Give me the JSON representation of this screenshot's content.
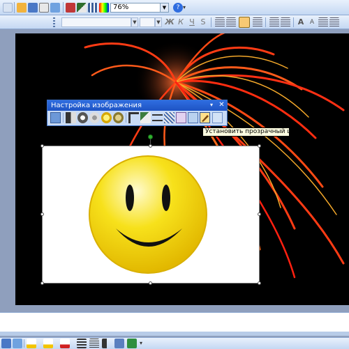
{
  "toolbar": {
    "zoom_value": "76%",
    "font_name": "",
    "font_size": "",
    "formatting_letters": {
      "shadow": "S",
      "superscript": "A"
    }
  },
  "picture_toolbar": {
    "title": "Настройка изображения",
    "close_glyph": "✕",
    "menu_glyph": "▾",
    "tooltip": "Установить прозрачный цвет"
  },
  "colors": {
    "slide_background": "#000000",
    "firework": "#ff3b14",
    "smiley_yellow": "#f7e11b",
    "title_bar": "#2f6de0"
  },
  "icons": [
    "print-icon",
    "open-icon",
    "save-icon",
    "table-icon",
    "chart-icon",
    "color-icon",
    "help-icon",
    "italic-icon",
    "underline-icon",
    "align-left-icon",
    "center-icon",
    "align-right-icon",
    "justify-icon",
    "bullets-icon",
    "insert-picture-icon",
    "set-transparent-color-icon"
  ]
}
